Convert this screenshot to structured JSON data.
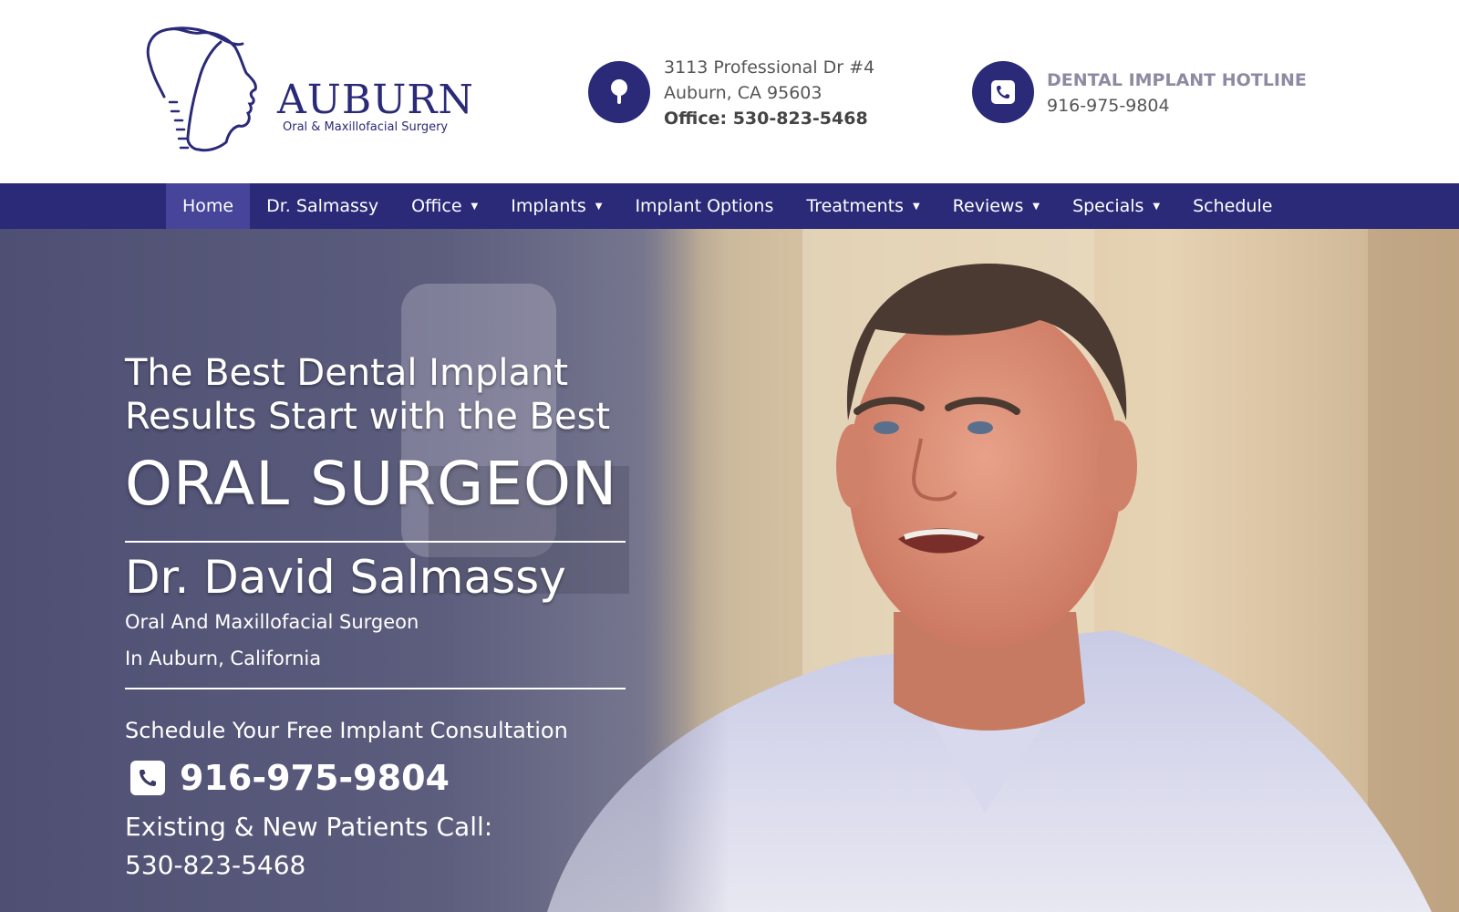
{
  "brand": {
    "name": "AUBURN",
    "tagline": "Oral & Maxillofacial Surgery",
    "logo_icon": "tooth-face-profile-icon",
    "accent_color": "#2b2a78"
  },
  "contact": {
    "address_icon": "map-pin-icon",
    "address_line1": "3113 Professional Dr #4",
    "address_line2": "Auburn, CA 95603",
    "office_phone": "Office: 530-823-5468",
    "hotline_icon": "phone-icon",
    "hotline_title": "DENTAL IMPLANT HOTLINE",
    "hotline_phone": "916-975-9804"
  },
  "nav": {
    "items": [
      {
        "label": "Home",
        "active": true,
        "dropdown": false
      },
      {
        "label": "Dr. Salmassy",
        "active": false,
        "dropdown": false
      },
      {
        "label": "Office",
        "active": false,
        "dropdown": true
      },
      {
        "label": "Implants",
        "active": false,
        "dropdown": true
      },
      {
        "label": "Implant Options",
        "active": false,
        "dropdown": false
      },
      {
        "label": "Treatments",
        "active": false,
        "dropdown": true
      },
      {
        "label": "Reviews",
        "active": false,
        "dropdown": true
      },
      {
        "label": "Specials",
        "active": false,
        "dropdown": true
      },
      {
        "label": "Schedule",
        "active": false,
        "dropdown": false
      }
    ],
    "caret_icon": "caret-down-icon"
  },
  "hero": {
    "headline_line1": "The Best Dental Implant",
    "headline_line2": "Results Start with the Best",
    "headline_big": "ORAL SURGEON",
    "doctor_name": "Dr. David Salmassy",
    "specialty": "Oral And Maxillofacial Surgeon",
    "location": "In Auburn, California",
    "schedule_text": "Schedule Your Free Implant Consultation",
    "phone_icon": "phone-icon",
    "phone": "916-975-9804",
    "existing_text": "Existing & New Patients Call:",
    "existing_phone": "530-823-5468",
    "image": "doctor-portrait-photo"
  }
}
